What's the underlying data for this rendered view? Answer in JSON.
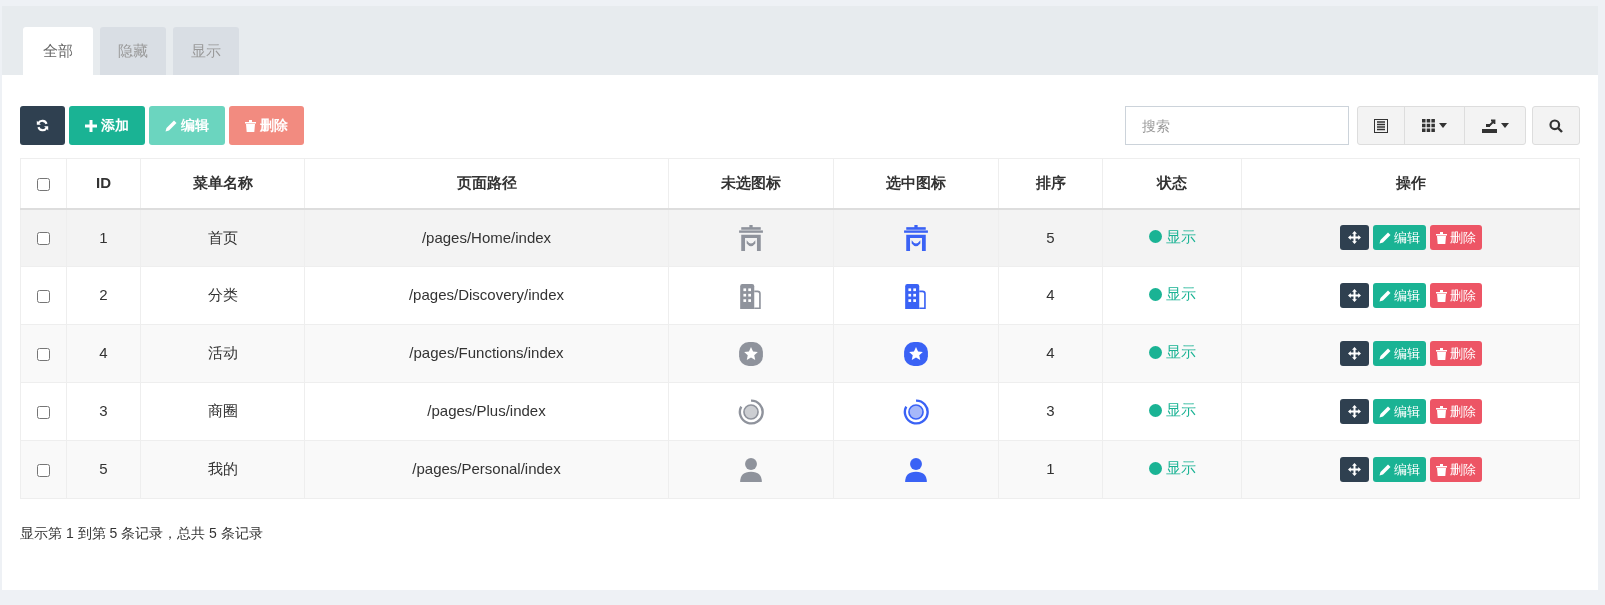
{
  "tabs": [
    {
      "label": "全部",
      "selected": true
    },
    {
      "label": "隐藏",
      "selected": false
    },
    {
      "label": "显示",
      "selected": false
    }
  ],
  "toolbar": {
    "buttons": [
      {
        "kind": "refresh",
        "disabled": false
      },
      {
        "kind": "add",
        "label": "添加",
        "disabled": false
      },
      {
        "kind": "edit",
        "label": "编辑",
        "disabled": true
      },
      {
        "kind": "delete",
        "label": "删除",
        "disabled": true
      }
    ],
    "search": {
      "placeholder": "搜索"
    }
  },
  "table": {
    "select_all_checked": false,
    "columns": [
      "ID",
      "菜单名称",
      "页面路径",
      "未选图标",
      "选中图标",
      "排序",
      "状态",
      "操作"
    ],
    "rows": [
      {
        "checked": false,
        "kind": "gate",
        "id": "1",
        "name": "首页",
        "path": "/pages/Home/index",
        "sort": "5",
        "status": "显示",
        "actions": [
          "编辑",
          "删除"
        ]
      },
      {
        "checked": false,
        "kind": "building",
        "id": "2",
        "name": "分类",
        "path": "/pages/Discovery/index",
        "sort": "4",
        "status": "显示",
        "actions": [
          "编辑",
          "删除"
        ]
      },
      {
        "checked": false,
        "kind": "star",
        "id": "4",
        "name": "活动",
        "path": "/pages/Functions/index",
        "sort": "4",
        "status": "显示",
        "actions": [
          "编辑",
          "删除"
        ]
      },
      {
        "checked": false,
        "kind": "ring",
        "id": "3",
        "name": "商圈",
        "path": "/pages/Plus/index",
        "sort": "3",
        "status": "显示",
        "actions": [
          "编辑",
          "删除"
        ]
      },
      {
        "checked": false,
        "kind": "person",
        "id": "5",
        "name": "我的",
        "path": "/pages/Personal/index",
        "sort": "1",
        "status": "显示",
        "actions": [
          "编辑",
          "删除"
        ]
      }
    ]
  },
  "footer": "显示第 1 到第 5 条记录，总共 5 条记录"
}
